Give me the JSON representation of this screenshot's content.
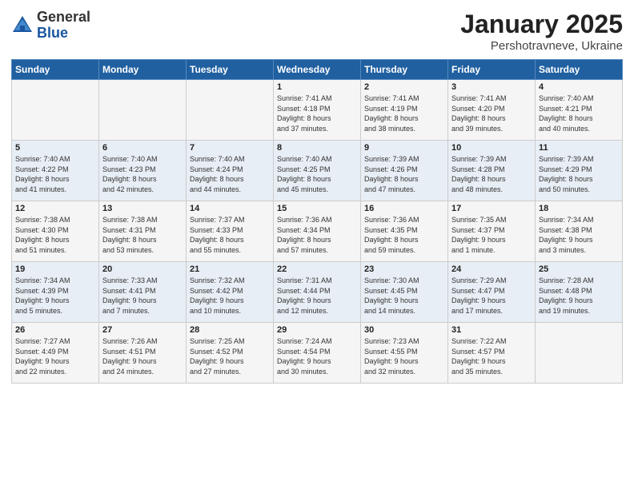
{
  "header": {
    "logo_general": "General",
    "logo_blue": "Blue",
    "title": "January 2025",
    "subtitle": "Pershotravneve, Ukraine"
  },
  "days_of_week": [
    "Sunday",
    "Monday",
    "Tuesday",
    "Wednesday",
    "Thursday",
    "Friday",
    "Saturday"
  ],
  "weeks": [
    [
      {
        "day": "",
        "info": ""
      },
      {
        "day": "",
        "info": ""
      },
      {
        "day": "",
        "info": ""
      },
      {
        "day": "1",
        "info": "Sunrise: 7:41 AM\nSunset: 4:18 PM\nDaylight: 8 hours\nand 37 minutes."
      },
      {
        "day": "2",
        "info": "Sunrise: 7:41 AM\nSunset: 4:19 PM\nDaylight: 8 hours\nand 38 minutes."
      },
      {
        "day": "3",
        "info": "Sunrise: 7:41 AM\nSunset: 4:20 PM\nDaylight: 8 hours\nand 39 minutes."
      },
      {
        "day": "4",
        "info": "Sunrise: 7:40 AM\nSunset: 4:21 PM\nDaylight: 8 hours\nand 40 minutes."
      }
    ],
    [
      {
        "day": "5",
        "info": "Sunrise: 7:40 AM\nSunset: 4:22 PM\nDaylight: 8 hours\nand 41 minutes."
      },
      {
        "day": "6",
        "info": "Sunrise: 7:40 AM\nSunset: 4:23 PM\nDaylight: 8 hours\nand 42 minutes."
      },
      {
        "day": "7",
        "info": "Sunrise: 7:40 AM\nSunset: 4:24 PM\nDaylight: 8 hours\nand 44 minutes."
      },
      {
        "day": "8",
        "info": "Sunrise: 7:40 AM\nSunset: 4:25 PM\nDaylight: 8 hours\nand 45 minutes."
      },
      {
        "day": "9",
        "info": "Sunrise: 7:39 AM\nSunset: 4:26 PM\nDaylight: 8 hours\nand 47 minutes."
      },
      {
        "day": "10",
        "info": "Sunrise: 7:39 AM\nSunset: 4:28 PM\nDaylight: 8 hours\nand 48 minutes."
      },
      {
        "day": "11",
        "info": "Sunrise: 7:39 AM\nSunset: 4:29 PM\nDaylight: 8 hours\nand 50 minutes."
      }
    ],
    [
      {
        "day": "12",
        "info": "Sunrise: 7:38 AM\nSunset: 4:30 PM\nDaylight: 8 hours\nand 51 minutes."
      },
      {
        "day": "13",
        "info": "Sunrise: 7:38 AM\nSunset: 4:31 PM\nDaylight: 8 hours\nand 53 minutes."
      },
      {
        "day": "14",
        "info": "Sunrise: 7:37 AM\nSunset: 4:33 PM\nDaylight: 8 hours\nand 55 minutes."
      },
      {
        "day": "15",
        "info": "Sunrise: 7:36 AM\nSunset: 4:34 PM\nDaylight: 8 hours\nand 57 minutes."
      },
      {
        "day": "16",
        "info": "Sunrise: 7:36 AM\nSunset: 4:35 PM\nDaylight: 8 hours\nand 59 minutes."
      },
      {
        "day": "17",
        "info": "Sunrise: 7:35 AM\nSunset: 4:37 PM\nDaylight: 9 hours\nand 1 minute."
      },
      {
        "day": "18",
        "info": "Sunrise: 7:34 AM\nSunset: 4:38 PM\nDaylight: 9 hours\nand 3 minutes."
      }
    ],
    [
      {
        "day": "19",
        "info": "Sunrise: 7:34 AM\nSunset: 4:39 PM\nDaylight: 9 hours\nand 5 minutes."
      },
      {
        "day": "20",
        "info": "Sunrise: 7:33 AM\nSunset: 4:41 PM\nDaylight: 9 hours\nand 7 minutes."
      },
      {
        "day": "21",
        "info": "Sunrise: 7:32 AM\nSunset: 4:42 PM\nDaylight: 9 hours\nand 10 minutes."
      },
      {
        "day": "22",
        "info": "Sunrise: 7:31 AM\nSunset: 4:44 PM\nDaylight: 9 hours\nand 12 minutes."
      },
      {
        "day": "23",
        "info": "Sunrise: 7:30 AM\nSunset: 4:45 PM\nDaylight: 9 hours\nand 14 minutes."
      },
      {
        "day": "24",
        "info": "Sunrise: 7:29 AM\nSunset: 4:47 PM\nDaylight: 9 hours\nand 17 minutes."
      },
      {
        "day": "25",
        "info": "Sunrise: 7:28 AM\nSunset: 4:48 PM\nDaylight: 9 hours\nand 19 minutes."
      }
    ],
    [
      {
        "day": "26",
        "info": "Sunrise: 7:27 AM\nSunset: 4:49 PM\nDaylight: 9 hours\nand 22 minutes."
      },
      {
        "day": "27",
        "info": "Sunrise: 7:26 AM\nSunset: 4:51 PM\nDaylight: 9 hours\nand 24 minutes."
      },
      {
        "day": "28",
        "info": "Sunrise: 7:25 AM\nSunset: 4:52 PM\nDaylight: 9 hours\nand 27 minutes."
      },
      {
        "day": "29",
        "info": "Sunrise: 7:24 AM\nSunset: 4:54 PM\nDaylight: 9 hours\nand 30 minutes."
      },
      {
        "day": "30",
        "info": "Sunrise: 7:23 AM\nSunset: 4:55 PM\nDaylight: 9 hours\nand 32 minutes."
      },
      {
        "day": "31",
        "info": "Sunrise: 7:22 AM\nSunset: 4:57 PM\nDaylight: 9 hours\nand 35 minutes."
      },
      {
        "day": "",
        "info": ""
      }
    ]
  ]
}
